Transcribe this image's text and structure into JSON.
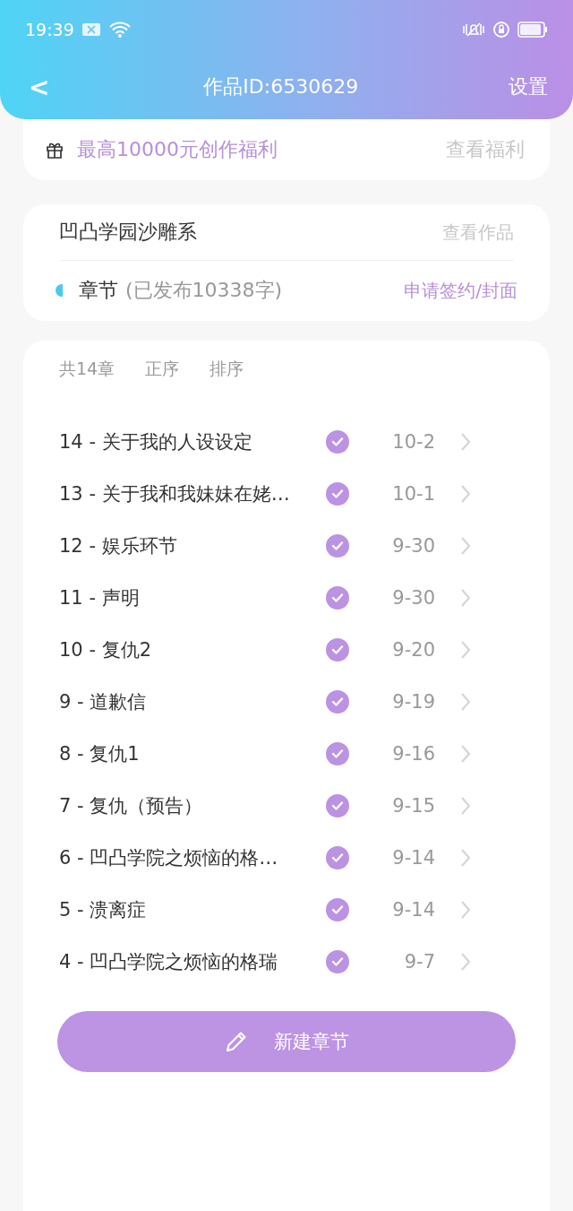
{
  "status_bar": {
    "time": "19:39"
  },
  "nav": {
    "back": "<",
    "title": "作品ID:6530629",
    "action": "设置"
  },
  "welfare": {
    "text": "最高10000元创作福利",
    "link": "查看福利"
  },
  "work": {
    "name": "凹凸学园沙雕系",
    "view_link": "查看作品",
    "section": "章节",
    "published_info": "(已发布10338字)",
    "apply_link": "申请签约/封面"
  },
  "chapter_list": {
    "count": "共14章",
    "sort_order": "正序",
    "sort_button": "排序",
    "chapters": [
      {
        "title": "14 - 关于我的人设设定",
        "published": true,
        "date": "10-2"
      },
      {
        "title": "13 - 关于我和我妹妹在姥…",
        "published": true,
        "date": "10-1"
      },
      {
        "title": "12 - 娱乐环节",
        "published": true,
        "date": "9-30"
      },
      {
        "title": "11 - 声明",
        "published": true,
        "date": "9-30"
      },
      {
        "title": "10 - 复仇2",
        "published": true,
        "date": "9-20"
      },
      {
        "title": "9 - 道歉信",
        "published": true,
        "date": "9-19"
      },
      {
        "title": "8 - 复仇1",
        "published": true,
        "date": "9-16"
      },
      {
        "title": "7 - 复仇（预告）",
        "published": true,
        "date": "9-15"
      },
      {
        "title": "6 - 凹凸学院之烦恼的格…",
        "published": true,
        "date": "9-14"
      },
      {
        "title": "5 - 溃离症",
        "published": true,
        "date": "9-14"
      },
      {
        "title": "4 - 凹凸学院之烦恼的格瑞",
        "published": true,
        "date": "9-7"
      }
    ]
  },
  "new_chapter_button": "新建章节"
}
